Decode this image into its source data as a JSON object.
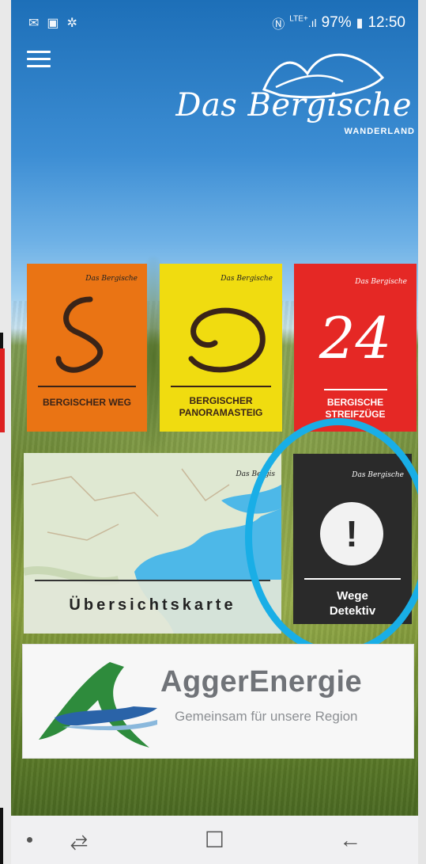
{
  "status_bar": {
    "left_icons": [
      "mail-icon",
      "flipboard-icon",
      "settings-sun-icon"
    ],
    "network": "LTE+",
    "battery_percent": "97%",
    "time": "12:50"
  },
  "header": {
    "logo_text": "Das Bergische",
    "logo_sub": "WANDERLAND"
  },
  "tiles": {
    "weg": {
      "label": "BERGISCHER WEG",
      "mini_logo": "Das Bergische",
      "color": "#ea7414"
    },
    "panorama": {
      "label_line1": "BERGISCHER",
      "label_line2": "PANORAMASTEIG",
      "mini_logo": "Das Bergische",
      "color": "#f0dc10"
    },
    "streif": {
      "number": "24",
      "label_line1": "BERGISCHE",
      "label_line2": "STREIFZÜGE",
      "mini_logo": "Das Bergische",
      "color": "#e52825"
    },
    "karte": {
      "label": "Übersichtskarte",
      "mini_logo": "Das Bergis"
    },
    "detektiv": {
      "label_line1": "Wege",
      "label_line2": "Detektiv",
      "mini_logo": "Das Bergische",
      "alert_symbol": "!"
    }
  },
  "ad": {
    "title": "AggerEnergie",
    "subtitle": "Gemeinsam für unsere Region"
  },
  "nav": {
    "recents": "⥄",
    "home": "☐",
    "back": "←"
  },
  "colors": {
    "highlight": "#19aee6"
  }
}
